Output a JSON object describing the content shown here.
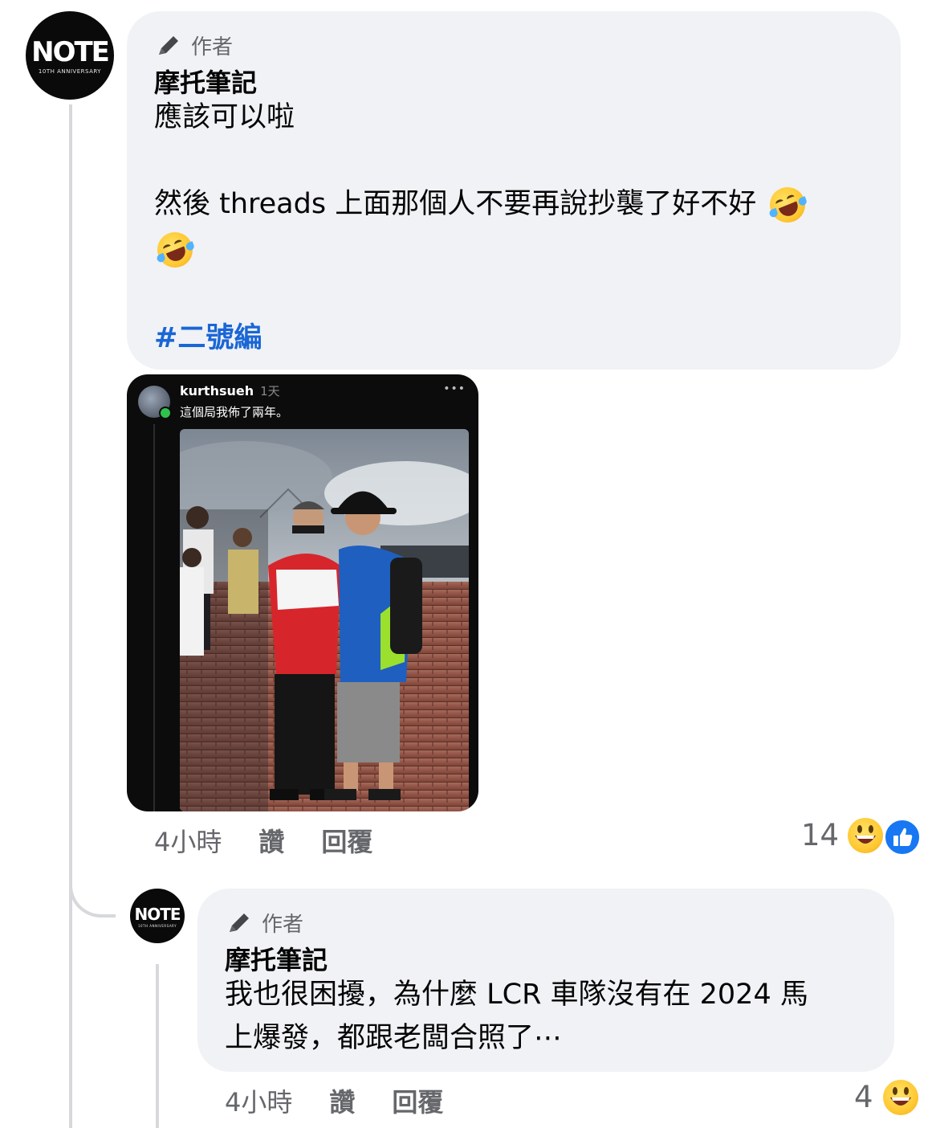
{
  "comment": {
    "author_badge": "作者",
    "author_name": "摩托筆記",
    "line1": "應該可以啦",
    "line2": "然後 threads 上面那個人不要再說抄襲了好不好",
    "hashtag": "#二號編",
    "emoji": "rolling-on-floor-laughing",
    "time": "4小時",
    "like_label": "讚",
    "reply_label": "回覆",
    "reaction_count": "14",
    "reactions": [
      "grinning-face",
      "like-thumb"
    ],
    "avatar_logo": "NOTE",
    "avatar_sub": "10TH ANNIVERSARY"
  },
  "shared_post": {
    "username": "kurthsueh",
    "time": "1天",
    "caption": "這個局我佈了兩年。",
    "more": "•••"
  },
  "reply": {
    "author_badge": "作者",
    "author_name": "摩托筆記",
    "line1": "我也很困擾，為什麼 LCR 車隊沒有在 2024 馬",
    "line2": "上爆發，都跟老闆合照了⋯",
    "time": "4小時",
    "like_label": "讚",
    "reply_label": "回覆",
    "reaction_count": "4",
    "reactions": [
      "grinning-face"
    ],
    "avatar_logo": "NOTE",
    "avatar_sub": "10TH ANNIVERSARY"
  },
  "colors": {
    "bubble": "#f0f2f5",
    "meta_text": "#65676b",
    "hashtag": "#1a66d6",
    "like_blue": "#1877f2"
  }
}
